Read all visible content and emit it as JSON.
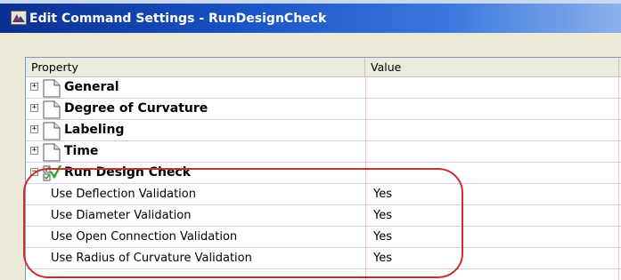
{
  "window": {
    "title": "Edit Command Settings - RunDesignCheck",
    "icon": "app-icon"
  },
  "grid": {
    "columns": {
      "property": "Property",
      "value": "Value"
    },
    "categories": [
      {
        "label": "General",
        "expanded": false,
        "expander_glyph": "+",
        "icon": "page-icon"
      },
      {
        "label": "Degree of Curvature",
        "expanded": false,
        "expander_glyph": "+",
        "icon": "page-icon"
      },
      {
        "label": "Labeling",
        "expanded": false,
        "expander_glyph": "+",
        "icon": "page-icon"
      },
      {
        "label": "Time",
        "expanded": false,
        "expander_glyph": "+",
        "icon": "page-icon"
      },
      {
        "label": "Run Design Check",
        "expanded": true,
        "expander_glyph": "−",
        "icon": "checklist-icon"
      }
    ],
    "properties": [
      {
        "name": "Use Deflection Validation",
        "value": "Yes"
      },
      {
        "name": "Use Diameter Validation",
        "value": "Yes"
      },
      {
        "name": "Use Open Connection Validation",
        "value": "Yes"
      },
      {
        "name": "Use Radius of Curvature Validation",
        "value": "Yes"
      }
    ]
  },
  "annotation": {
    "color": "#c8302e"
  }
}
